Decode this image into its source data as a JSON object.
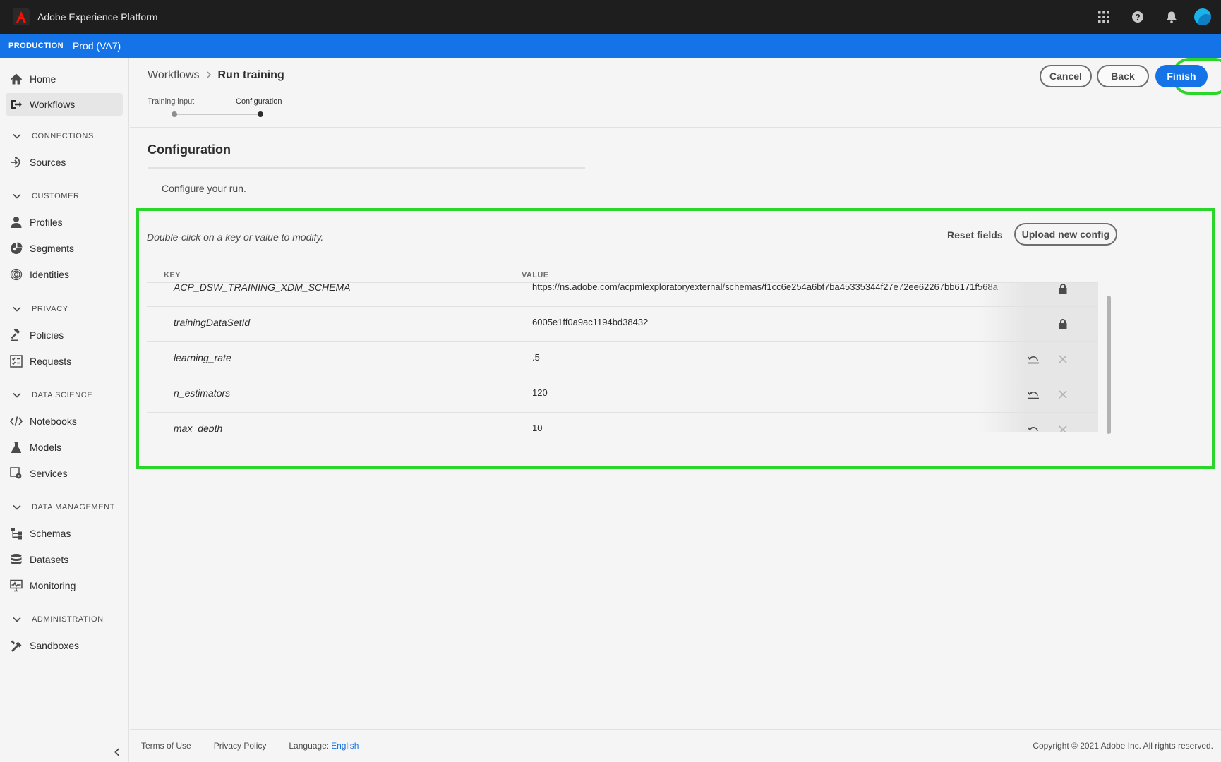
{
  "app": {
    "title": "Adobe Experience Platform"
  },
  "env": {
    "label": "PRODUCTION",
    "name": "Prod (VA7)"
  },
  "sidebar": {
    "items": {
      "home": "Home",
      "workflows": "Workflows",
      "sources": "Sources",
      "profiles": "Profiles",
      "segments": "Segments",
      "identities": "Identities",
      "policies": "Policies",
      "requests": "Requests",
      "notebooks": "Notebooks",
      "models": "Models",
      "services": "Services",
      "schemas": "Schemas",
      "datasets": "Datasets",
      "monitoring": "Monitoring",
      "sandboxes": "Sandboxes"
    },
    "sections": {
      "connections": "CONNECTIONS",
      "customer": "CUSTOMER",
      "privacy": "PRIVACY",
      "data_science": "DATA SCIENCE",
      "data_management": "DATA MANAGEMENT",
      "administration": "ADMINISTRATION"
    },
    "active": "workflows"
  },
  "breadcrumb": {
    "parent": "Workflows",
    "current": "Run training"
  },
  "steps": {
    "step1": "Training input",
    "step2": "Configuration",
    "current": 2
  },
  "actions": {
    "cancel": "Cancel",
    "back": "Back",
    "finish": "Finish"
  },
  "config": {
    "title": "Configuration",
    "description": "Configure your run.",
    "hint": "Double-click on a key or value to modify.",
    "reset": "Reset fields",
    "upload": "Upload new config",
    "columns": {
      "key": "KEY",
      "value": "VALUE"
    },
    "rows": [
      {
        "key": "ACP_DSW_TRAINING_XDM_SCHEMA",
        "value": "https://ns.adobe.com/acpmlexploratoryexternal/schemas/f1cc6e254a6bf7ba45335344f27e72ee62267bb6171f568a",
        "locked": true
      },
      {
        "key": "trainingDataSetId",
        "value": "6005e1ff0a9ac1194bd38432",
        "locked": true
      },
      {
        "key": "learning_rate",
        "value": ".5",
        "locked": false
      },
      {
        "key": "n_estimators",
        "value": "120",
        "locked": false
      },
      {
        "key": "max_depth",
        "value": "10",
        "locked": false
      }
    ]
  },
  "footer": {
    "terms": "Terms of Use",
    "privacy": "Privacy Policy",
    "language_label": "Language:",
    "language_value": "English",
    "copyright": "Copyright ©  2021 Adobe Inc.  All rights reserved."
  },
  "colors": {
    "accent": "#1473e6",
    "highlight": "#2bd62a",
    "topbar": "#1e1e1e"
  }
}
